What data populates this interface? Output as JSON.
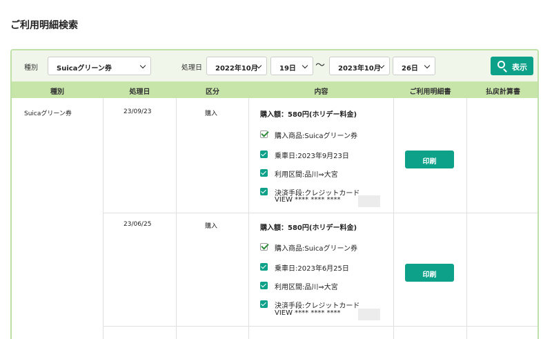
{
  "page_title": "ご利用明細検索",
  "search": {
    "type_label": "種別",
    "type_value": "Suicaグリーン券",
    "date_label": "処理日",
    "from_month": "2022年10月",
    "from_day": "19日",
    "separator": "〜",
    "to_month": "2023年10月",
    "to_day": "26日",
    "search_button": "表示"
  },
  "table": {
    "headers": [
      "種別",
      "処理日",
      "区分",
      "内容",
      "ご利用明細書",
      "払戻計算書"
    ],
    "type_cell": "Suicaグリーン券",
    "rows": [
      {
        "date": "23/09/23",
        "category": "購入",
        "amount": "購入額：580円(ホリデー料金)",
        "items": [
          "購入商品:Suicaグリーン券",
          "乗車日:2023年9月23日",
          "利用区間:品川⇒大宮",
          "決済手段:クレジットカード"
        ],
        "card": "VIEW **** **** ****",
        "print_button": "印刷"
      },
      {
        "date": "23/06/25",
        "category": "購入",
        "amount": "購入額：580円(ホリデー料金)",
        "items": [
          "購入商品:Suicaグリーン券",
          "乗車日:2023年6月25日",
          "利用区間:品川⇒大宮",
          "決済手段:クレジットカード"
        ],
        "card": "VIEW **** **** ****",
        "print_button": "印刷"
      }
    ]
  },
  "colors": {
    "accent": "#0ea18a",
    "header_bg": "#c7e4a9",
    "search_bg": "#f0f6ea",
    "panel_border": "#bfe0a8"
  }
}
